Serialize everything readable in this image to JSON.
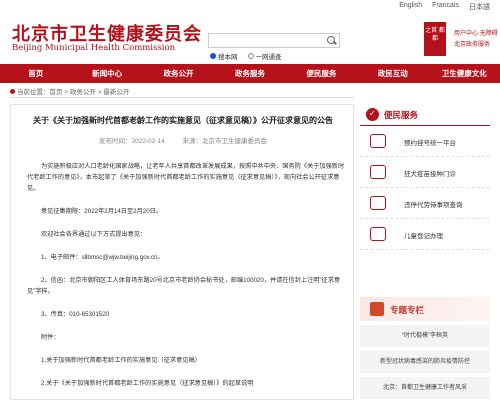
{
  "lang": [
    "English",
    "Francais",
    "日本語"
  ],
  "header": {
    "title_zh": "北京市卫生健康委员会",
    "title_en": "Beijing Municipal Health Commission",
    "badge": "之首 都都",
    "search_placeholder": "",
    "radio_site": "搜本网",
    "radio_all": "一网通查",
    "user_center": "用户中心",
    "accessible": "无障碍",
    "gov_service": "北京政务服务"
  },
  "nav": [
    "首页",
    "新闻中心",
    "政务公开",
    "政务服务",
    "便民服务",
    "政民互动",
    "卫生健康文化"
  ],
  "breadcrumb": "当前位置：首页 > 政务公开 > 最新公开",
  "article": {
    "title": "关于《关于加强新时代首都老龄工作的实施意见（征求意见稿）》公开征求意见的公告",
    "date": "发布时间：2022-02-14",
    "source": "来源：北京市卫生健康委员会",
    "paragraphs": [
      "为实施积极应对人口老龄化国家战略，让老年人共享首都改革发展成果，按照中共中央、国务院《关于加强新时代老龄工作的意见》，本市起草了《关于加强新时代首都老龄工作的实施意见（征求意见稿）》，现向社会公开征求意见。",
      "意见征集期限：2022年2月14日至2月20日。",
      "欢迎社会各界通过以下方式提出意见：",
      "1、电子邮件：sllbmsc@wjw.beijing.gov.cn。",
      "2、信函：北京市朝阳区工人体育场东路20号北京市老龄协会秘书处，邮编100020，并请在信封上注明“征求意见”字样。",
      "3、传真：010-65301520",
      "附件：",
      "1.关于加强新时代首都老龄工作的实施意见（征求意见稿）",
      "2.关于《关于加强新时代首都老龄工作的实施意见（征求意见稿）》的起草说明"
    ]
  },
  "sidebar": {
    "heading": "便民服务",
    "services": [
      "预约挂号统一平台",
      "狂犬疫苗接种门诊",
      "违停代劳待事项查询",
      "儿童登记办理"
    ],
    "topics_heading": "专题专栏",
    "topics": [
      "“时代楷模”李桓英",
      "新型冠状病毒感染的肺炎疫情防控",
      "北京：首都卫生健康工作者风采"
    ]
  }
}
